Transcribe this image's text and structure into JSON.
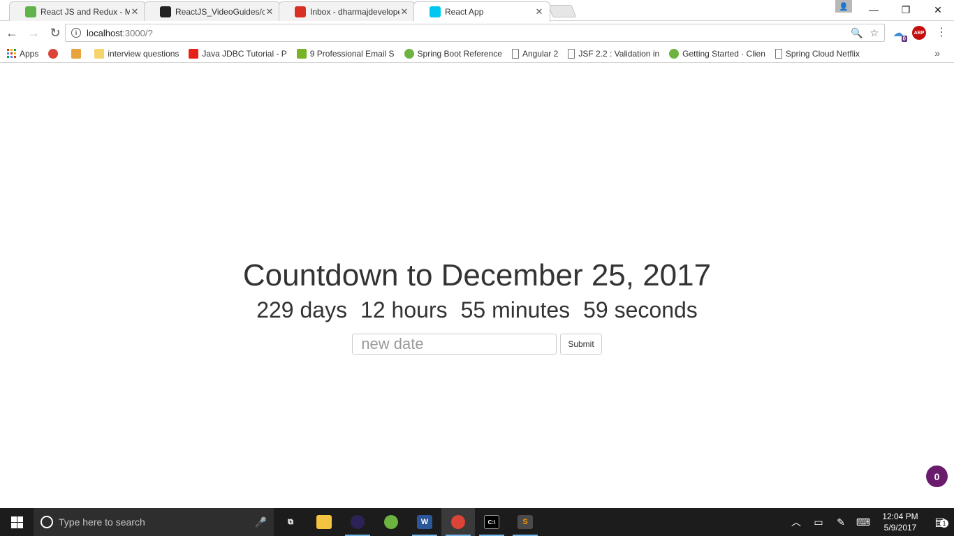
{
  "browser": {
    "tabs": [
      {
        "title": "React JS and Redux - Ma",
        "icon": "udemy-icon",
        "color": "#5fb34a"
      },
      {
        "title": "ReactJS_VideoGuides/co",
        "icon": "github-icon",
        "color": "#222222"
      },
      {
        "title": "Inbox - dharmajdevelope",
        "icon": "gmail-icon",
        "color": "#d93025"
      },
      {
        "title": "React App",
        "icon": "react-icon",
        "color": "#00c8f0"
      }
    ],
    "active_tab_index": 3,
    "close_glyph": "✕",
    "window_controls": {
      "minimize": "—",
      "restore": "❐",
      "close": "✕"
    },
    "profile_glyph": "👤"
  },
  "toolbar": {
    "back_glyph": "←",
    "forward_glyph": "→",
    "reload_glyph": "↻",
    "url_host": "localhost",
    "url_path": ":3000/?",
    "info_glyph": "i",
    "zoom_glyph": "🔍",
    "star_glyph": "☆",
    "ext_badge": "0",
    "abp_label": "ABP",
    "menu_glyph": "⋮"
  },
  "bookmarks": {
    "items": [
      {
        "label": "Apps",
        "icon": "apps-icon"
      },
      {
        "label": "",
        "icon": "chrome-icon"
      },
      {
        "label": "",
        "icon": "flash-icon"
      },
      {
        "label": "interview questions",
        "icon": "folder-icon"
      },
      {
        "label": "Java JDBC Tutorial - P",
        "icon": "youtube-icon"
      },
      {
        "label": "9 Professional Email S",
        "icon": "yoast-icon"
      },
      {
        "label": "Spring Boot Reference",
        "icon": "spring-icon"
      },
      {
        "label": "Angular 2",
        "icon": "page-icon"
      },
      {
        "label": "JSF 2.2 : Validation in",
        "icon": "jsf-icon"
      },
      {
        "label": "Getting Started · Clien",
        "icon": "spring-icon"
      },
      {
        "label": "Spring Cloud Netflix",
        "icon": "page-icon"
      }
    ],
    "more_glyph": "»"
  },
  "app": {
    "title": "Countdown to December 25, 2017",
    "days": "229 days",
    "hours": "12 hours",
    "minutes": "55 minutes",
    "seconds": "59 seconds",
    "input_placeholder": "new date",
    "submit_label": "Submit",
    "badge_count": "0"
  },
  "taskbar": {
    "search_placeholder": "Type here to search",
    "mic_glyph": "🎤",
    "time": "12:04 PM",
    "date": "5/9/2017",
    "notification_count": "1",
    "apps": [
      {
        "name": "task-view-icon",
        "glyph": "⧉",
        "color": "#ffffff",
        "bg": "transparent",
        "open": false,
        "active": false
      },
      {
        "name": "file-explorer-icon",
        "glyph": "",
        "color": "#f5c342",
        "bg": "#f5c342",
        "open": false,
        "active": false
      },
      {
        "name": "eclipse-icon",
        "glyph": "",
        "color": "#2c2255",
        "bg": "#2c2255",
        "open": true,
        "active": false
      },
      {
        "name": "spring-tool-icon",
        "glyph": "",
        "color": "#6db33f",
        "bg": "#6db33f",
        "open": false,
        "active": false
      },
      {
        "name": "word-icon",
        "glyph": "W",
        "color": "#2b579a",
        "bg": "#2b579a",
        "open": true,
        "active": false
      },
      {
        "name": "chrome-icon",
        "glyph": "",
        "color": "#db4437",
        "bg": "#db4437",
        "open": true,
        "active": true
      },
      {
        "name": "terminal-icon",
        "glyph": "C:\\",
        "color": "#000000",
        "bg": "#000000",
        "open": true,
        "active": false
      },
      {
        "name": "sublime-icon",
        "glyph": "S",
        "color": "#ff9800",
        "bg": "#4a4a4a",
        "open": true,
        "active": false
      }
    ]
  },
  "colors": {
    "accent": "#6a1b6e",
    "taskbar": "#1c1c1c",
    "text": "#333333"
  }
}
